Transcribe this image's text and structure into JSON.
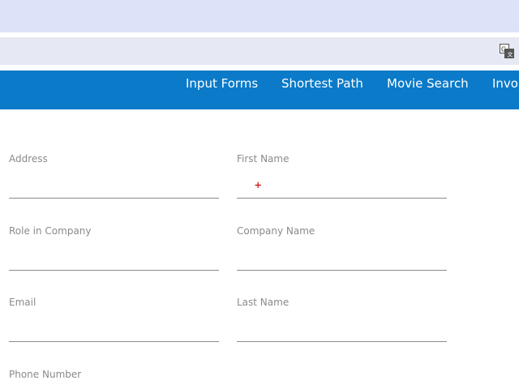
{
  "toolbar": {
    "translate_icon": "translate-icon"
  },
  "nav": {
    "items": [
      {
        "label": "Input Forms"
      },
      {
        "label": "Shortest Path"
      },
      {
        "label": "Movie Search"
      },
      {
        "label": "Invo"
      }
    ],
    "background_color": "#0a7ac9"
  },
  "form": {
    "fields": [
      {
        "label": "Address",
        "value": ""
      },
      {
        "label": "First Name",
        "value": ""
      },
      {
        "label": "Role in Company",
        "value": ""
      },
      {
        "label": "Company Name",
        "value": ""
      },
      {
        "label": "Email",
        "value": ""
      },
      {
        "label": "Last Name",
        "value": ""
      },
      {
        "label": "Phone Number",
        "value": ""
      }
    ]
  },
  "cursor": {
    "glyph": "+",
    "color": "#cc0000"
  }
}
